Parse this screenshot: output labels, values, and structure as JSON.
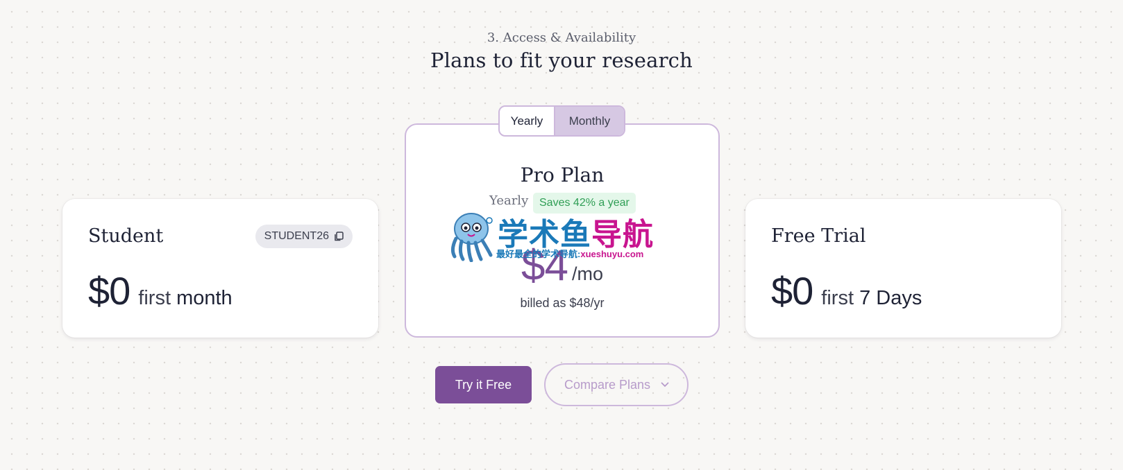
{
  "header": {
    "eyebrow": "3. Access & Availability",
    "title": "Plans to fit your research"
  },
  "billing_toggle": {
    "options": [
      "Yearly",
      "Monthly"
    ],
    "selected": "Monthly"
  },
  "plans": {
    "student": {
      "name": "Student",
      "promo_code": "STUDENT26",
      "price": "$0",
      "period_prefix": "first",
      "period_unit": "month"
    },
    "pro": {
      "name": "Pro Plan",
      "billing_label": "Yearly",
      "savings_badge": "Saves 42% a year",
      "price": "$4",
      "unit": "/mo",
      "billed_note": "billed as $48/yr"
    },
    "free_trial": {
      "name": "Free Trial",
      "price": "$0",
      "period_prefix": "first",
      "period_unit": "7 Days"
    }
  },
  "actions": {
    "primary": "Try it Free",
    "secondary": "Compare Plans"
  },
  "watermark": {
    "main_part1": "学术鱼",
    "main_part2": "导航",
    "sub_part1": "最好最全的学术导航:",
    "sub_part2": "xueshuyu.com"
  },
  "colors": {
    "accent": "#7b4e98",
    "accent_light": "#d6c8e3",
    "border": "#cdb8dc",
    "badge_bg": "#e4f7ea",
    "badge_text": "#2f9e55"
  },
  "icons": [
    "copy-icon",
    "chevron-down-icon",
    "octopus-mascot-icon"
  ]
}
